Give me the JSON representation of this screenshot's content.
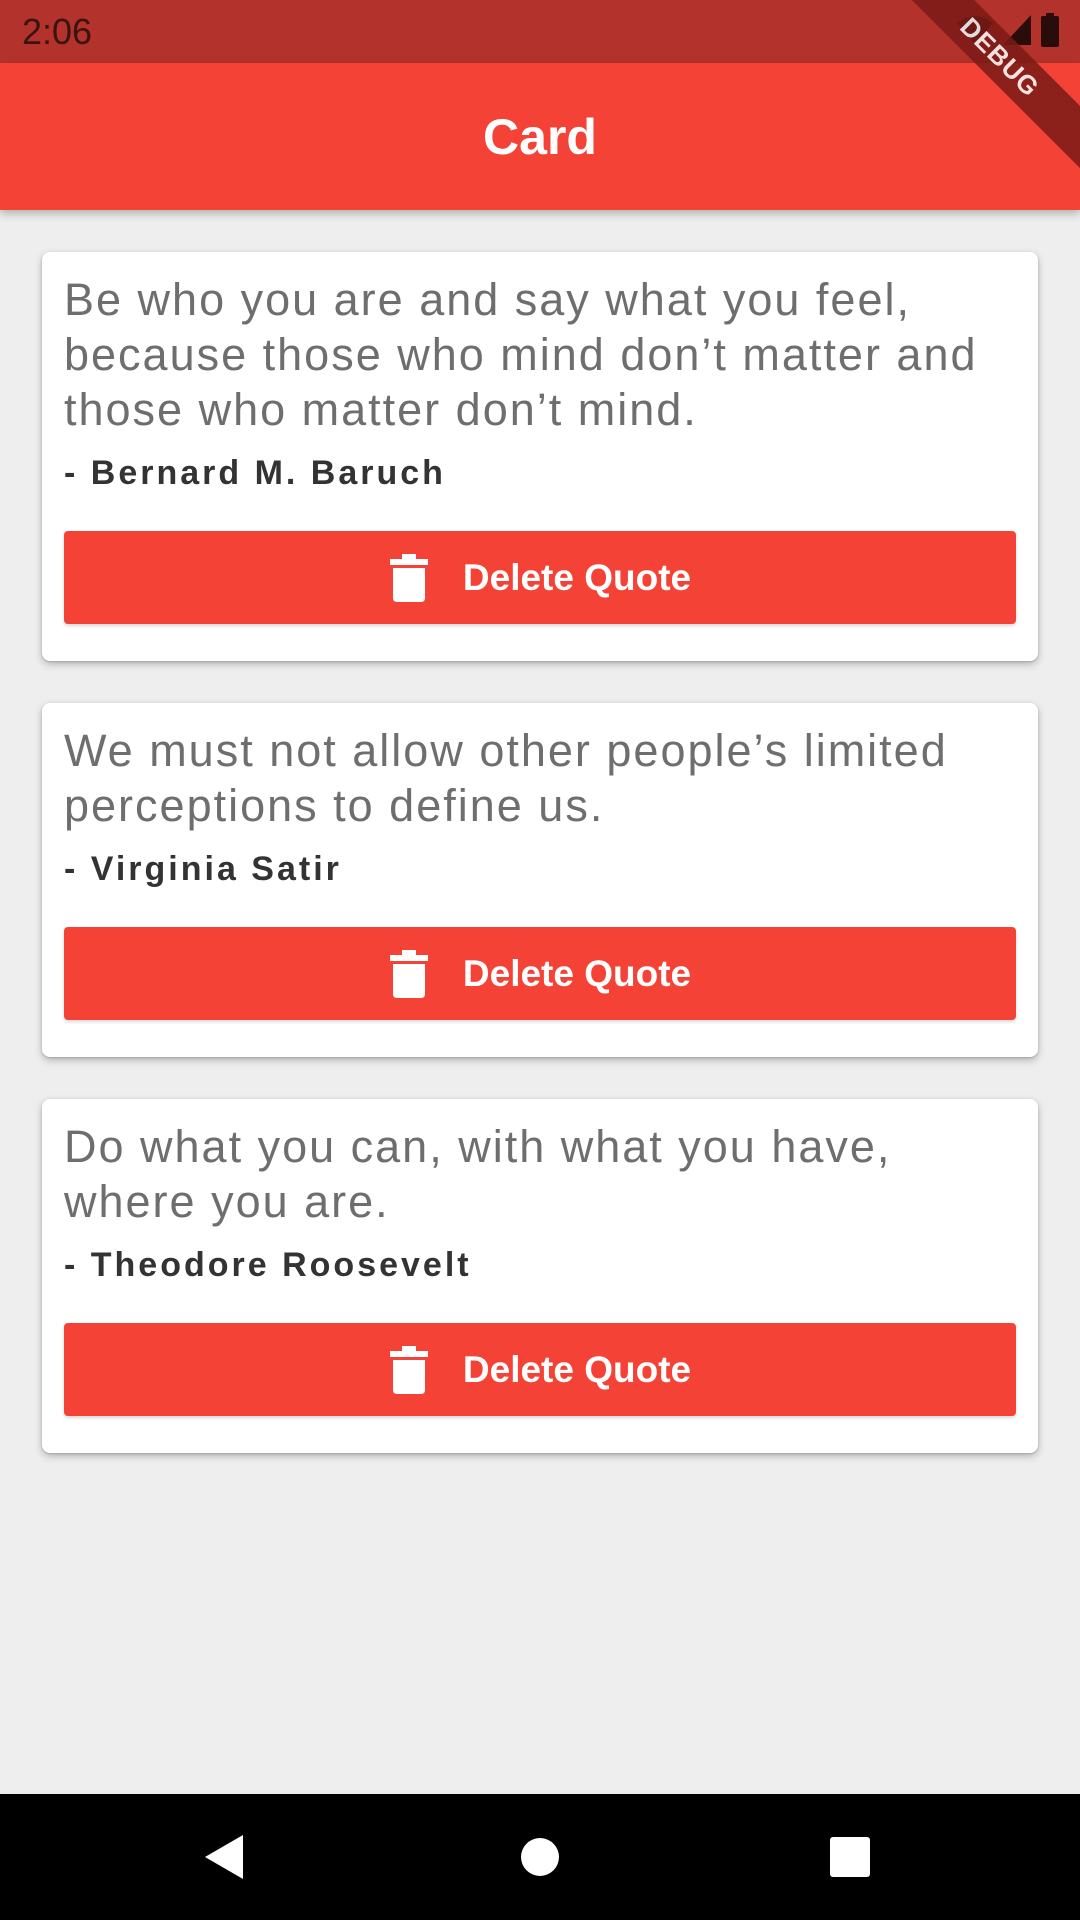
{
  "status_bar": {
    "time": "2:06",
    "icons": [
      "wifi-icon",
      "signal-icon",
      "battery-icon"
    ]
  },
  "app_bar": {
    "title": "Card",
    "color": "#f44336"
  },
  "debug_banner": "DEBUG",
  "quotes": [
    {
      "text": "Be who you are and say what you feel, because those who mind don’t matter and those who matter don’t mind.",
      "author": "- Bernard M. Baruch",
      "button_label": "Delete Quote"
    },
    {
      "text": "We must not allow other people’s limited perceptions to define us.",
      "author": "- Virginia Satir",
      "button_label": "Delete Quote"
    },
    {
      "text": "Do what you can, with what you have, where you are.",
      "author": "- Theodore Roosevelt",
      "button_label": "Delete Quote"
    }
  ],
  "nav_bar": {
    "items": [
      "back-icon",
      "home-icon",
      "recents-icon"
    ]
  },
  "colors": {
    "accent": "#f44336",
    "status_bar": "#b3322b",
    "background": "#eeeeee"
  }
}
